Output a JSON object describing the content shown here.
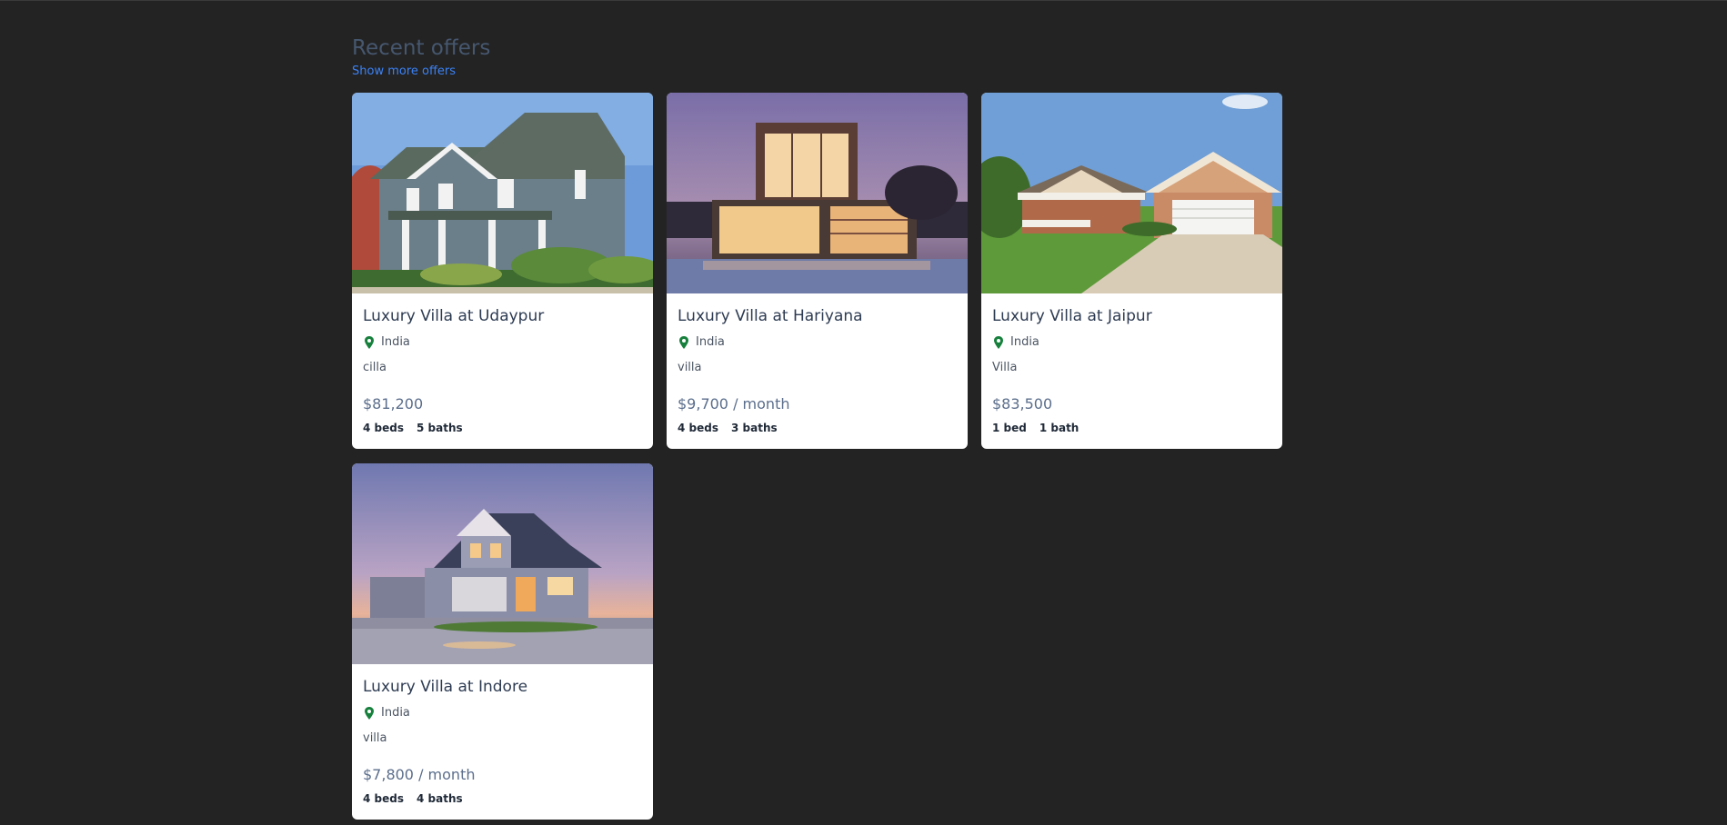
{
  "section": {
    "title": "Recent offers",
    "more_link": "Show more offers"
  },
  "offers": [
    {
      "title": "Luxury Villa at Udaypur",
      "location": "India",
      "type": "cilla",
      "price": "$81,200",
      "beds": "4 beds",
      "baths": "5 baths",
      "image": "gray two-story house with porch and garden"
    },
    {
      "title": "Luxury Villa at Hariyana",
      "location": "India",
      "type": "villa",
      "price": "$9,700 / month",
      "beds": "4 beds",
      "baths": "3 baths",
      "image": "modern lit cube villa with pool at dusk"
    },
    {
      "title": "Luxury Villa at Jaipur",
      "location": "India",
      "type": "Villa",
      "price": "$83,500",
      "beds": "1 bed",
      "baths": "1 bath",
      "image": "brick ranch house with garage and lawn"
    },
    {
      "title": "Luxury Villa at Indore",
      "location": "India",
      "type": "villa",
      "price": "$7,800 / month",
      "beds": "4 beds",
      "baths": "4 baths",
      "image": "house at sunset with lit windows and wet driveway"
    }
  ],
  "colors": {
    "page_bg": "#232323",
    "title": "#46576f",
    "link": "#3b82f6",
    "pin": "#16803c"
  },
  "icons": {
    "location": "map-pin-icon"
  }
}
